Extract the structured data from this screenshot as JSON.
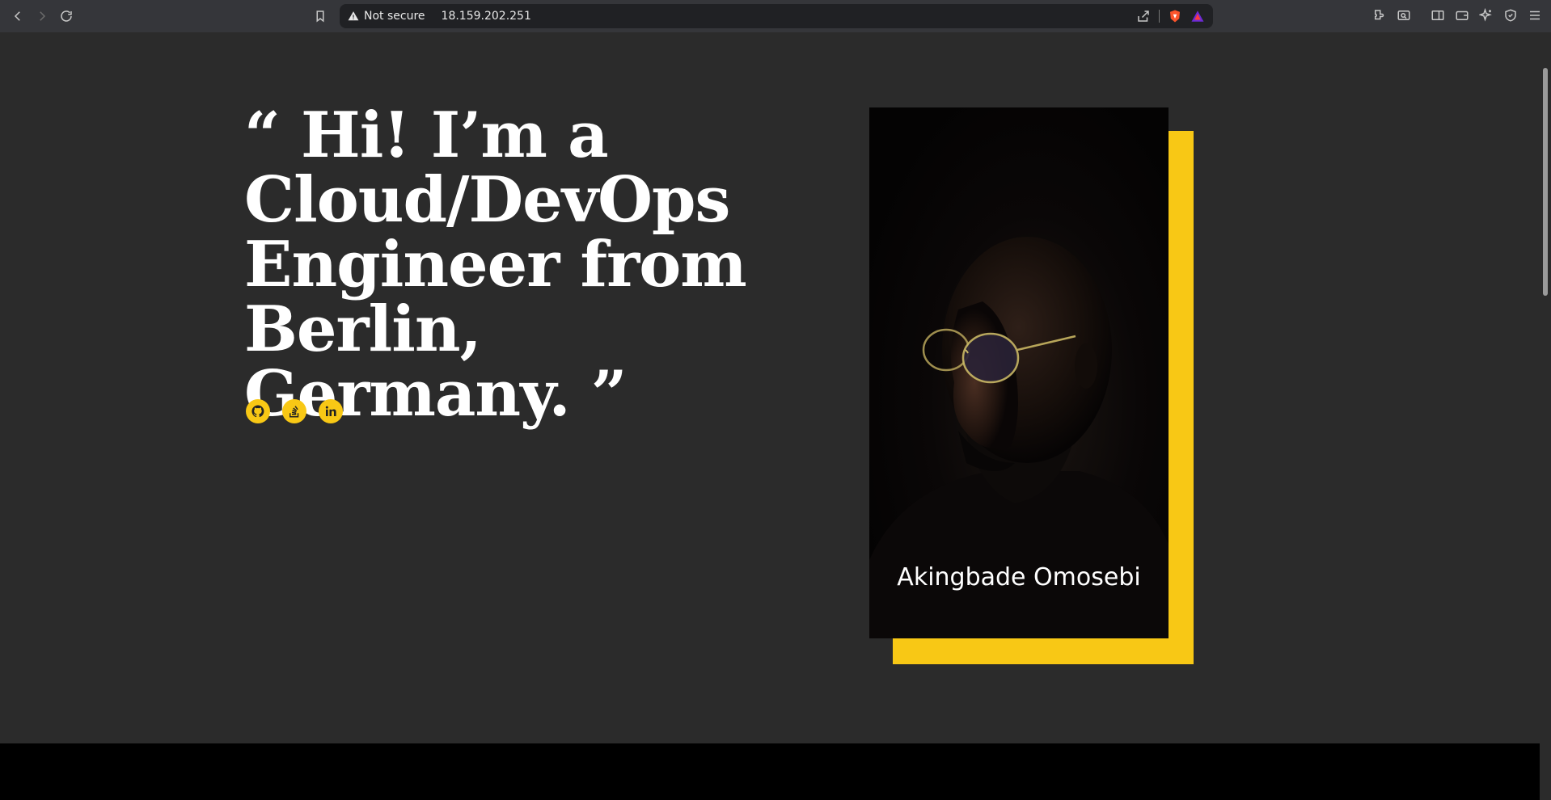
{
  "browser": {
    "security_label": "Not secure",
    "url": "18.159.202.251"
  },
  "hero": {
    "title": "“ Hi! I’m a Cloud/DevOps Engineer from Berlin, Germany. ”",
    "socials": [
      {
        "name": "github-icon"
      },
      {
        "name": "stackoverflow-icon"
      },
      {
        "name": "linkedin-icon"
      }
    ]
  },
  "photo": {
    "caption": "Akingbade Omosebi"
  },
  "colors": {
    "accent": "#f8c815",
    "background": "#2b2b2b",
    "footer": "#000000"
  }
}
